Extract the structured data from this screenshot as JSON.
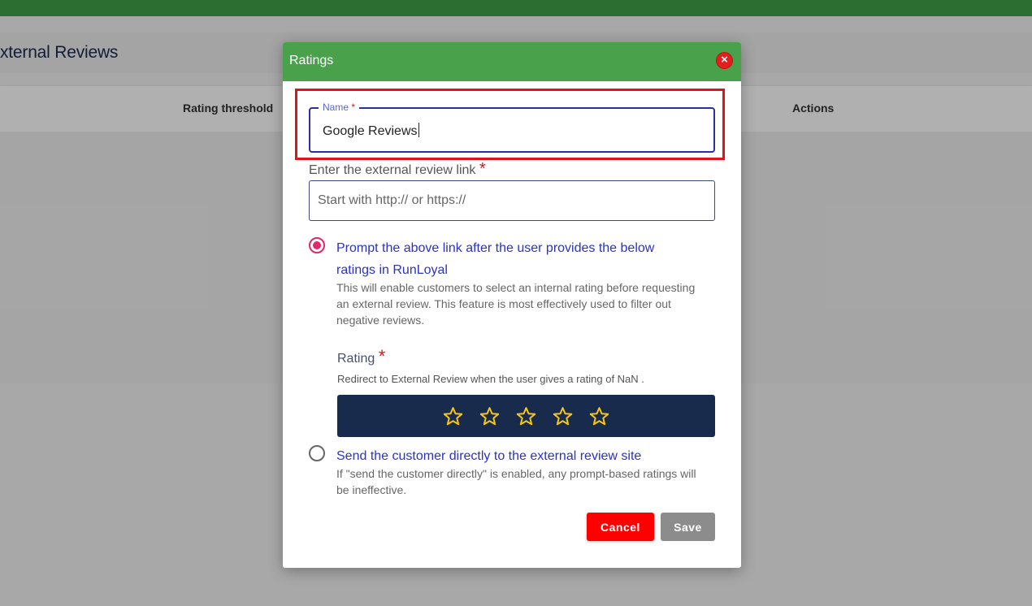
{
  "background": {
    "page_title": "xternal Reviews",
    "columns": {
      "rating_threshold": "Rating threshold",
      "actions": "Actions"
    }
  },
  "modal": {
    "title": "Ratings",
    "close_icon": "close-icon",
    "name_field": {
      "label": "Name",
      "required_mark": "*",
      "value": "Google Reviews"
    },
    "link_field": {
      "label": "Enter the external review link",
      "required_mark": "*",
      "placeholder": "Start with http:// or https://",
      "value": ""
    },
    "option_prompt": {
      "selected": true,
      "title": "Prompt the above link after the user provides the below ratings in RunLoyal",
      "description": "This will enable customers to select an internal rating before requesting an external review. This feature is most effectively used to filter out negative reviews."
    },
    "rating": {
      "label": "Rating",
      "required_mark": "*",
      "hint": "Redirect to External Review when the user gives a rating of NaN .",
      "star_count": 5,
      "selected_stars": 0,
      "star_color": "#f5c518",
      "bar_color": "#182b4d"
    },
    "option_direct": {
      "selected": false,
      "title": "Send the customer directly to the external review site",
      "description": "If \"send the customer directly\" is enabled, any prompt-based ratings will be ineffective."
    },
    "buttons": {
      "cancel": "Cancel",
      "save": "Save"
    }
  },
  "colors": {
    "header_green": "#49a24b",
    "cancel_red": "#ff0000",
    "save_gray": "#8c8c8c",
    "highlight_red": "#e01414",
    "radio_pink": "#e5266c",
    "option_blue": "#2a33c2"
  }
}
